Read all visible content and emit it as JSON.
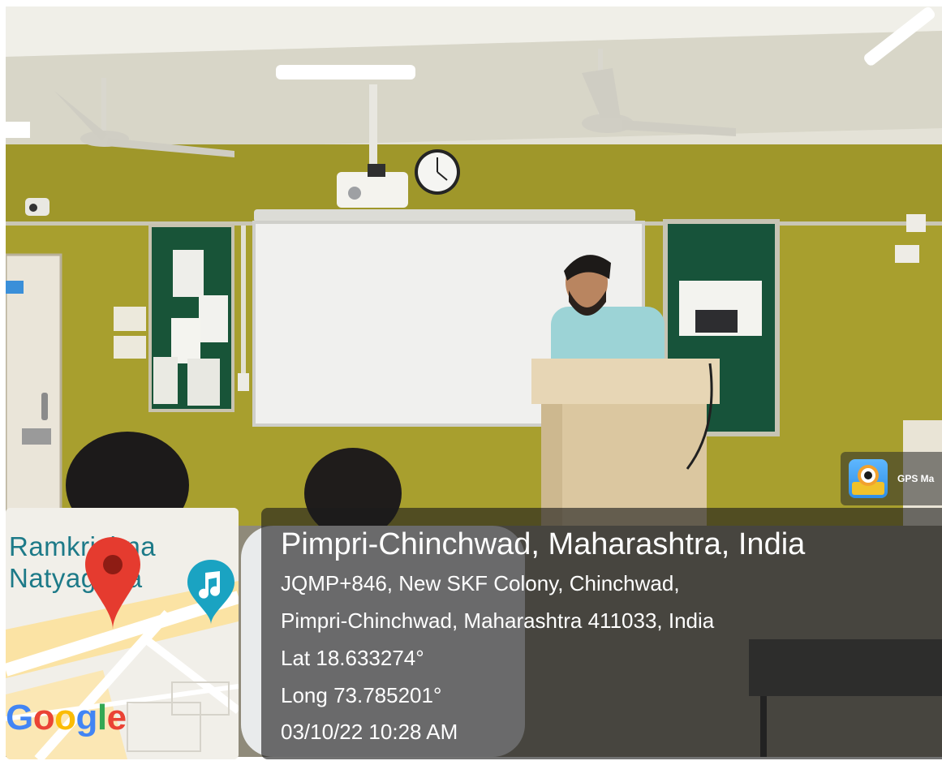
{
  "scene": {
    "description_icons": [
      "ceiling-fan",
      "projector",
      "wall-clock",
      "whiteboard",
      "notice-board",
      "podium",
      "speaker-person",
      "audience-person",
      "door",
      "cctv-camera"
    ],
    "colors": {
      "wall": "#a79d2c",
      "ceiling": "#e7e4da",
      "board_green": "#17533a",
      "podium": "#e2cfac",
      "shirt": "#98d4d5"
    }
  },
  "gps_badge": {
    "label": "GPS Ma",
    "icon": "gps-map-camera-app-icon"
  },
  "map": {
    "place_label": "Ramkrishna\nNatyagriha",
    "brand_letters": [
      "G",
      "o",
      "o",
      "g",
      "l",
      "e"
    ],
    "pin_color": "#e53b2f",
    "music_marker_color": "#1aa3c2"
  },
  "info": {
    "title": "Pimpri-Chinchwad, Maharashtra, India",
    "address_line1": "JQMP+846, New SKF Colony, Chinchwad,",
    "address_line2": "Pimpri-Chinchwad, Maharashtra 411033, India",
    "lat": "Lat 18.633274°",
    "long": "Long 73.785201°",
    "datetime": "03/10/22 10:28 AM"
  }
}
